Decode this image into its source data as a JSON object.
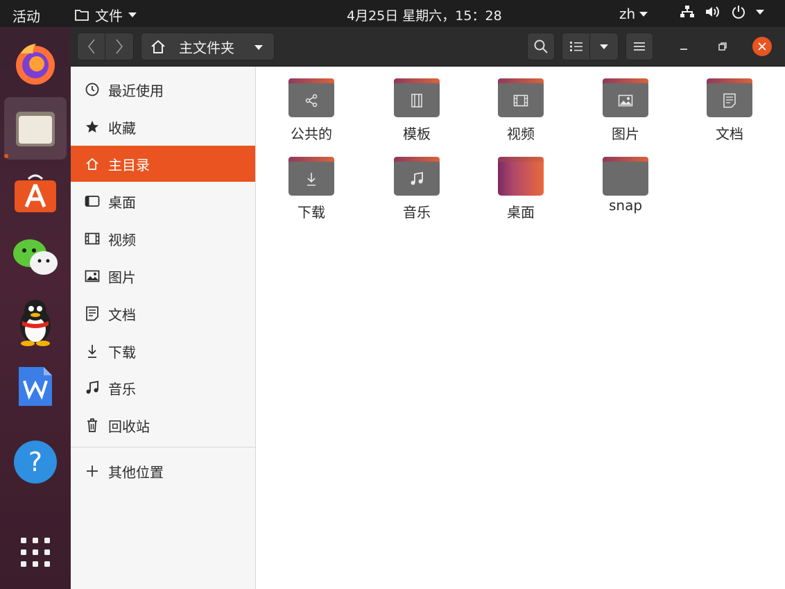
{
  "topbar": {
    "activities": "活动",
    "app_menu": "文件",
    "clock": "4月25日 星期六，15：28",
    "lang": "zh"
  },
  "dock": {
    "items": [
      "firefox-icon",
      "files-icon",
      "software-center-icon",
      "wechat-icon",
      "qq-icon",
      "wps-writer-icon",
      "help-icon",
      "show-apps-icon"
    ]
  },
  "headerbar": {
    "path_label": "主文件夹"
  },
  "sidebar": {
    "items": [
      {
        "label": "最近使用",
        "icon": "clock-icon"
      },
      {
        "label": "收藏",
        "icon": "star-icon"
      },
      {
        "label": "主目录",
        "icon": "home-icon",
        "selected": true
      },
      {
        "label": "桌面",
        "icon": "desktop-icon"
      },
      {
        "label": "视频",
        "icon": "video-icon"
      },
      {
        "label": "图片",
        "icon": "picture-icon"
      },
      {
        "label": "文档",
        "icon": "document-icon"
      },
      {
        "label": "下载",
        "icon": "download-icon"
      },
      {
        "label": "音乐",
        "icon": "music-icon"
      },
      {
        "label": "回收站",
        "icon": "trash-icon"
      }
    ],
    "other_locations": "其他位置"
  },
  "files": [
    {
      "name": "公共的",
      "emblem": "share-icon"
    },
    {
      "name": "模板",
      "emblem": "template-icon"
    },
    {
      "name": "视频",
      "emblem": "video-icon"
    },
    {
      "name": "图片",
      "emblem": "picture-icon"
    },
    {
      "name": "文档",
      "emblem": "document-icon"
    },
    {
      "name": "下载",
      "emblem": "download-icon"
    },
    {
      "name": "音乐",
      "emblem": "music-icon"
    },
    {
      "name": "桌面",
      "emblem": "desktop-folder-icon"
    },
    {
      "name": "snap",
      "emblem": "folder-icon"
    }
  ],
  "colors": {
    "accent": "#e95420",
    "topbar_bg": "#1e1e1e",
    "headerbar_bg": "#2c2c2c",
    "folder_gray": "#6b6b6b"
  }
}
